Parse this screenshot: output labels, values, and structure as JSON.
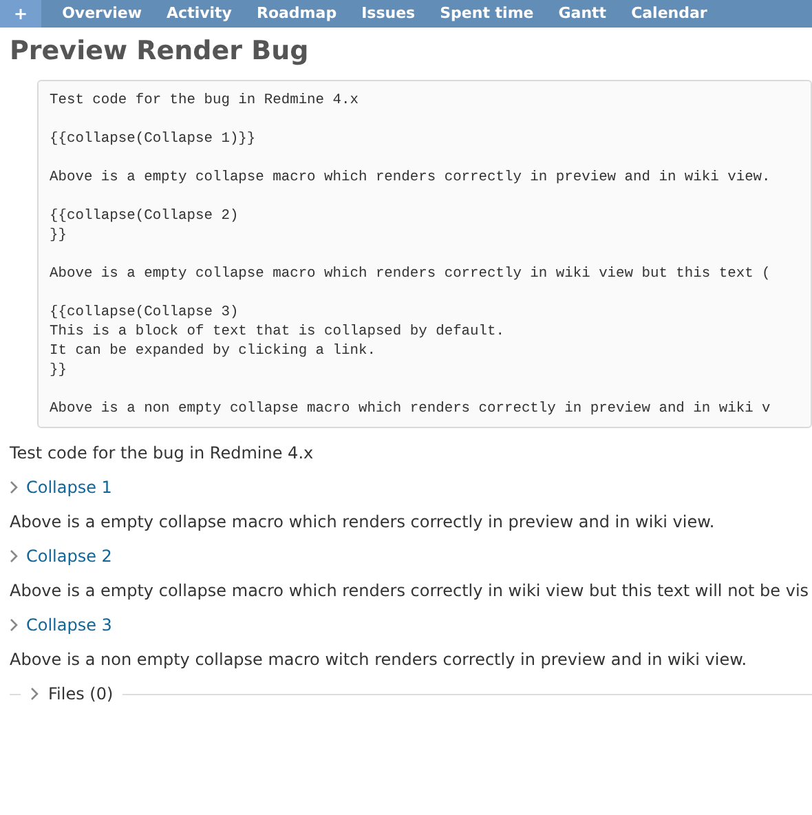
{
  "main_menu": {
    "new_button": "+",
    "tabs": [
      {
        "label": "Overview",
        "selected": false
      },
      {
        "label": "Activity",
        "selected": false
      },
      {
        "label": "Roadmap",
        "selected": false
      },
      {
        "label": "Issues",
        "selected": false
      },
      {
        "label": "Spent time",
        "selected": false
      },
      {
        "label": "Gantt",
        "selected": false
      },
      {
        "label": "Calendar",
        "selected": false
      }
    ]
  },
  "page_title": "Preview Render Bug",
  "code_block": [
    [
      "Test code for the bug in Redmine 4.x"
    ],
    [
      "{{collapse(Collapse 1)}}"
    ],
    [
      "Above is a empty collapse macro which renders correctly in preview and in wiki view."
    ],
    [
      "{{collapse(Collapse 2)",
      "}}"
    ],
    [
      "Above is a empty collapse macro which renders correctly in wiki view but this text ("
    ],
    [
      "{{collapse(Collapse 3)",
      "This is a block of text that is collapsed by default.",
      "It can be expanded by clicking a link.",
      "}}"
    ],
    [
      "Above is a non empty collapse macro which renders correctly in preview and in wiki v"
    ]
  ],
  "content": [
    {
      "kind": "text",
      "text": "Test code for the bug in Redmine 4.x"
    },
    {
      "kind": "collapse",
      "label": "Collapse 1",
      "expanded": false
    },
    {
      "kind": "text",
      "text": "Above is a empty collapse macro which renders correctly in preview and in wiki view."
    },
    {
      "kind": "collapse",
      "label": "Collapse 2",
      "expanded": false
    },
    {
      "kind": "text",
      "text": "Above is a empty collapse macro which renders correctly in wiki view but this text will not be vis"
    },
    {
      "kind": "collapse",
      "label": "Collapse 3",
      "expanded": false
    },
    {
      "kind": "text",
      "text": "Above is a non empty collapse macro witch renders correctly in preview and in wiki view."
    }
  ],
  "files": {
    "label": "Files (0)",
    "expanded": false
  }
}
